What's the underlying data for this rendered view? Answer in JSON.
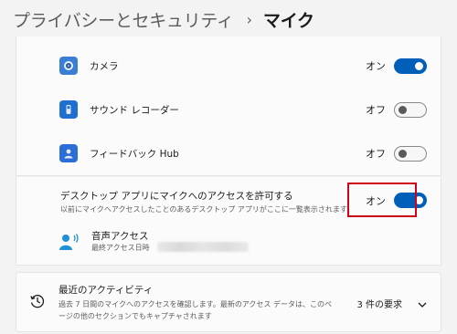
{
  "breadcrumb": {
    "parent": "プライバシーとセキュリティ",
    "separator": "›",
    "current": "マイク"
  },
  "apps": [
    {
      "name": "カメラ",
      "state_label": "オン",
      "on": true,
      "icon": "camera-icon",
      "icon_color": "#3a7fd5"
    },
    {
      "name": "サウンド レコーダー",
      "state_label": "オフ",
      "on": false,
      "icon": "voice-recorder-icon",
      "icon_color": "#1f6fcf"
    },
    {
      "name": "フィードバック Hub",
      "state_label": "オフ",
      "on": false,
      "icon": "feedback-hub-icon",
      "icon_color": "#2b6fd6"
    }
  ],
  "desktop": {
    "title": "デスクトップ アプリにマイクへのアクセスを許可する",
    "description": "以前にマイクへアクセスしたことのあるデスクトップ アプリがここに一覧表示されます",
    "state_label": "オン",
    "on": true,
    "voice_access": {
      "name": "音声アクセス",
      "last_access_label": "最終アクセス日時"
    }
  },
  "activity": {
    "title": "最近のアクティビティ",
    "description": "過去 7 日間のマイクへのアクセスを確認します。最新のアクセス データは、このページの他のセクションでもキャプチャされます",
    "count_label": "3 件の要求"
  },
  "colors": {
    "accent": "#005fb8",
    "highlight": "#d0021b"
  }
}
